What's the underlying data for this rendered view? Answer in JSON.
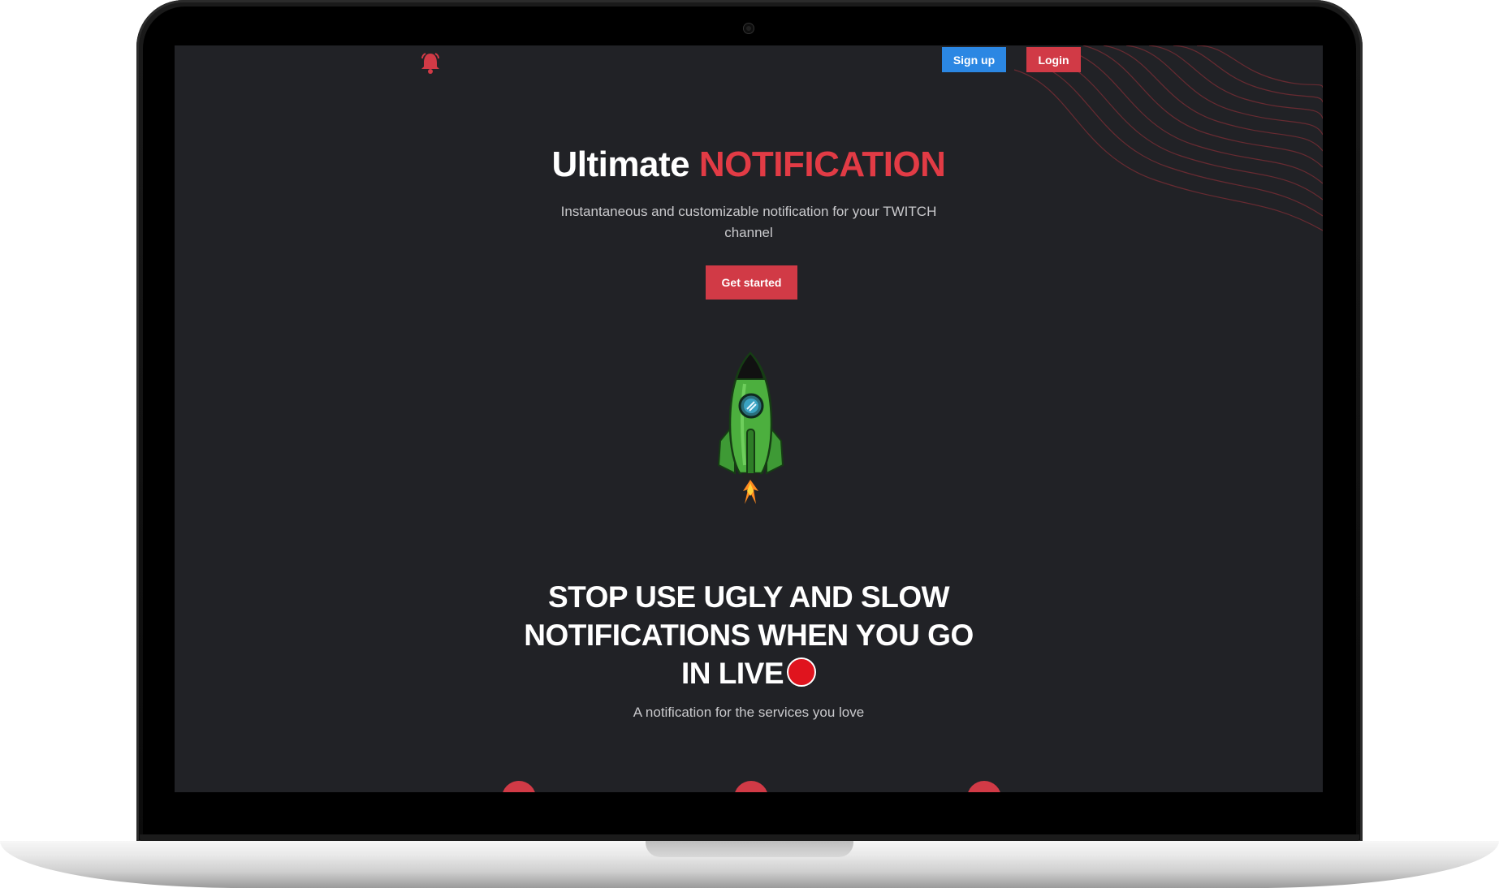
{
  "nav": {
    "signup_label": "Sign up",
    "login_label": "Login",
    "logo_icon": "bell-icon"
  },
  "hero": {
    "title_plain": "Ultimate",
    "title_accent": "NOTIFICATION",
    "subtitle": "Instantaneous and customizable notification for your TWITCH channel",
    "cta_label": "Get started",
    "illustration": "rocket-icon"
  },
  "section": {
    "title": "STOP USE UGLY AND SLOW NOTIFICATIONS WHEN YOU GO IN LIVE",
    "subtitle": "A notification for the services you love"
  },
  "colors": {
    "background": "#212226",
    "accent_red": "#d13a46",
    "signup_blue": "#2b87e3",
    "live_red": "#e0141e"
  }
}
